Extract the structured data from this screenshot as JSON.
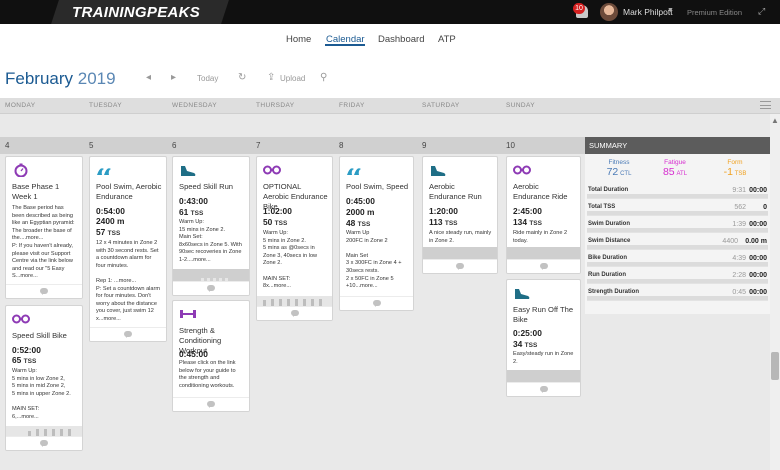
{
  "app": {
    "logo": "TRAININGPEAKS"
  },
  "header": {
    "notification_count": "10",
    "user_name": "Mark Philpott",
    "edition": "Premium Edition"
  },
  "nav": {
    "home": "Home",
    "calendar": "Calendar",
    "dashboard": "Dashboard",
    "atp": "ATP",
    "active": "Calendar"
  },
  "toolbar": {
    "month": "February",
    "year": "2019",
    "today": "Today",
    "upload": "Upload",
    "prev_glyph": "◂",
    "next_glyph": "▸",
    "refresh_glyph": "↻",
    "upload_glyph": "⇪",
    "search_glyph": "⚲"
  },
  "days": [
    "MONDAY",
    "TUESDAY",
    "WEDNESDAY",
    "THURSDAY",
    "FRIDAY",
    "SATURDAY",
    "SUNDAY"
  ],
  "dates": [
    "4",
    "5",
    "6",
    "7",
    "8",
    "9",
    "10"
  ],
  "summary": {
    "title": "SUMMARY",
    "fitness": {
      "label": "Fitness",
      "value": "72",
      "unit": "CTL",
      "color": "#4a7ab6"
    },
    "fatigue": {
      "label": "Fatigue",
      "value": "85",
      "unit": "ATL",
      "color": "#d62ccf"
    },
    "form": {
      "label": "Form",
      "value": "-1",
      "unit": "TSB",
      "color": "#f0a01e"
    },
    "rows": [
      {
        "label": "Total Duration",
        "planned": "9:31",
        "actual": "00:00"
      },
      {
        "label": "Total TSS",
        "planned": "562",
        "actual": "0"
      },
      {
        "label": "Swim Duration",
        "planned": "1:39",
        "actual": "00:00"
      },
      {
        "label": "Swim Distance",
        "planned": "4400",
        "actual": "0.00 m"
      },
      {
        "label": "Bike Duration",
        "planned": "4:39",
        "actual": "00:00"
      },
      {
        "label": "Run Duration",
        "planned": "2:28",
        "actual": "00:00"
      },
      {
        "label": "Strength Duration",
        "planned": "0:45",
        "actual": "00:00"
      }
    ]
  },
  "workouts": {
    "mon1": {
      "icon": "stopwatch-icon",
      "title": "Base Phase 1 Week 1",
      "desc": "The Base period has been described as being like an Egyptian pyramid: The broader the base of the....more...\nP: If you haven't already, please visit our Support Centre via the link below and read our \"5 Easy S...more..."
    },
    "mon2": {
      "icon": "bike-icon",
      "title": "Speed Skill Bike",
      "duration": "0:52:00",
      "tss": "65",
      "desc": "Warm Up:\n5 mins in low Zone 2,\n5 mins in mid Zone 2,\n5 mins in upper Zone 2.\n\nMAIN SET:\n6,...more..."
    },
    "tue1": {
      "icon": "swim-icon",
      "title": "Pool Swim, Aerobic Endurance",
      "duration": "0:54:00",
      "distance": "2400",
      "distance_unit": "m",
      "tss": "57",
      "desc": "12 x 4 minutes in Zone 2 with 30 second rests. Set a countdown alarm for four minutes.\n\nRep 1: ...more...\nP: Set a countdown alarm for four minutes. Don't worry about the distance you cover, just swim 12 x...more..."
    },
    "wed1": {
      "icon": "run-shoe-icon",
      "title": "Speed Skill Run",
      "duration": "0:43:00",
      "tss": "61",
      "desc": "Warm Up:\n15 mins in Zone 2.\nMain Set:\n8x60secs in Zone 5. With 90sec recoveries in Zone 1-2....more..."
    },
    "wed2": {
      "icon": "strength-icon",
      "title": "Strength & Conditioning Workout",
      "duration": "0:45:00",
      "desc": "Please click on the link below for your guide to the strength and conditioning workouts.\n\nmypro...more..."
    },
    "thu1": {
      "icon": "bike-icon",
      "title": "OPTIONAL Aerobic Endurance Bike",
      "duration": "1:02:00",
      "tss": "50",
      "desc": "Warm Up:\n5 mins in Zone 2.\n5 mins as @0secs in Zone 3, 40secs in low Zone 2.\n\nMAIN SET:\n8x...more..."
    },
    "fri1": {
      "icon": "swim-icon",
      "title": "Pool Swim, Speed",
      "duration": "0:45:00",
      "distance": "2000",
      "distance_unit": "m",
      "tss": "48",
      "desc": "Warm Up\n200FC in Zone 2\n\nMain Set\n3 x 300FC in Zone 4 + 30secs rests.\n2 x 50FC in Zone 5 +10...more..."
    },
    "sat1": {
      "icon": "run-shoe-icon",
      "title": "Aerobic Endurance Run",
      "duration": "1:20:00",
      "tss": "113",
      "desc": "A nice steady run, mainly in Zone 2."
    },
    "sun1": {
      "icon": "bike-icon",
      "title": "Aerobic Endurance Ride",
      "duration": "2:45:00",
      "tss": "134",
      "desc": "Ride mainly in Zone 2 today."
    },
    "sun2": {
      "icon": "run-shoe-icon",
      "title": "Easy Run Off The Bike",
      "duration": "0:25:00",
      "tss": "34",
      "desc": "Easy/steady run in Zone 2."
    }
  },
  "labels": {
    "tss_unit": "TSS"
  }
}
